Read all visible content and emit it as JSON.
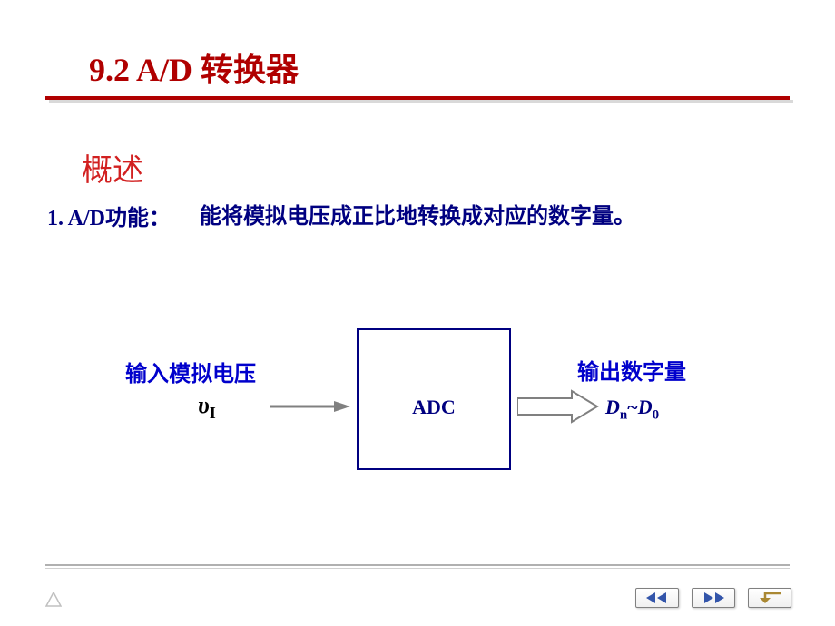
{
  "title": "9.2 A/D 转换器",
  "overview": "概述",
  "func_label": "1. A/D功能：",
  "func_desc": "能将模拟电压成正比地转换成对应的数字量。",
  "diagram": {
    "input_label": "输入模拟电压",
    "input_symbol_main": "υ",
    "input_symbol_sub": "I",
    "box_label": "ADC",
    "output_label": "输出数字量",
    "output_symbol_left_main": "D",
    "output_symbol_left_sub": "n",
    "output_symbol_tilde": "~",
    "output_symbol_right_main": "D",
    "output_symbol_right_sub": "0"
  },
  "nav": {
    "prev": "prev",
    "next": "next",
    "back": "back"
  }
}
